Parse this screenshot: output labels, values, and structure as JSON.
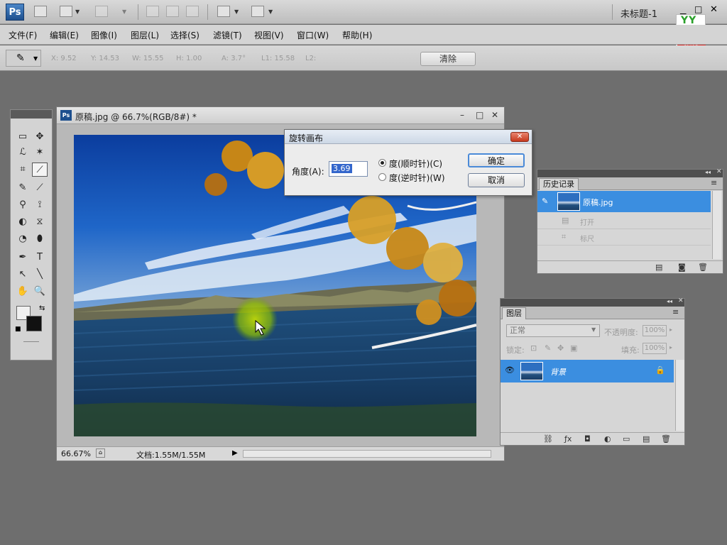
{
  "app": {
    "logo_text": "Ps",
    "document_title": "未标题-1",
    "win_minimize": "▁",
    "win_maximize": "□",
    "win_close": "✕",
    "brand_logo": {
      "top": "YY",
      "line1": "育碟",
      "line2": "教育"
    },
    "toolbar_icons": [
      "bridge-icon",
      "minibridge-icon",
      "undo-icon",
      "brush-icon",
      "stamp-icon",
      "eraser-icon",
      "arrange-icon",
      "screen-mode-icon"
    ]
  },
  "menu": [
    "文件(F)",
    "编辑(E)",
    "图像(I)",
    "图层(L)",
    "选择(S)",
    "滤镜(T)",
    "视图(V)",
    "窗口(W)",
    "帮助(H)"
  ],
  "options": {
    "tool_icon": "ruler-icon",
    "labels": [
      "X: 9.52",
      "Y: 14.53",
      "W: 15.55",
      "H: 1.00",
      "A: 3.7°",
      "L1: 15.58",
      "L2:"
    ],
    "clear_label": "清除"
  },
  "tools": {
    "icons": [
      [
        "▭",
        "✥"
      ],
      [
        "ℒ",
        "✶"
      ],
      [
        "⌗",
        "⟋"
      ],
      [
        "✎",
        "⟋"
      ],
      [
        "⚲",
        "⟟"
      ],
      [
        "◐",
        "⧖"
      ],
      [
        "◔",
        "⬮"
      ],
      [
        "✒",
        "T"
      ],
      [
        "↖",
        "╲"
      ],
      [
        "✋",
        "🔍"
      ]
    ]
  },
  "document": {
    "tab_label": "原稿.jpg @ 66.7%(RGB/8#) *",
    "zoom": "66.67%",
    "doc_size": "文档:1.55M/1.55M",
    "ctl_min": "–",
    "ctl_max": "□",
    "ctl_close": "✕"
  },
  "dialog": {
    "title": "旋转画布",
    "close": "✕",
    "angle_label": "角度(A):",
    "angle_value": "3.69",
    "radio_cw": "度(顺时针)(C)",
    "radio_ccw": "度(逆时针)(W)",
    "ok": "确定",
    "cancel": "取消"
  },
  "history": {
    "tab": "历史记录",
    "snapshot_name": "原稿.jpg",
    "rows": [
      {
        "icon": "▤",
        "label": "打开"
      },
      {
        "icon": "⌗",
        "label": "标尺"
      }
    ]
  },
  "layers": {
    "tab": "图层",
    "blend_mode": "正常",
    "opacity_label": "不透明度:",
    "opacity_value": "100%",
    "lock_label": "锁定:",
    "fill_label": "填充:",
    "fill_value": "100%",
    "layer_name": "背景"
  }
}
